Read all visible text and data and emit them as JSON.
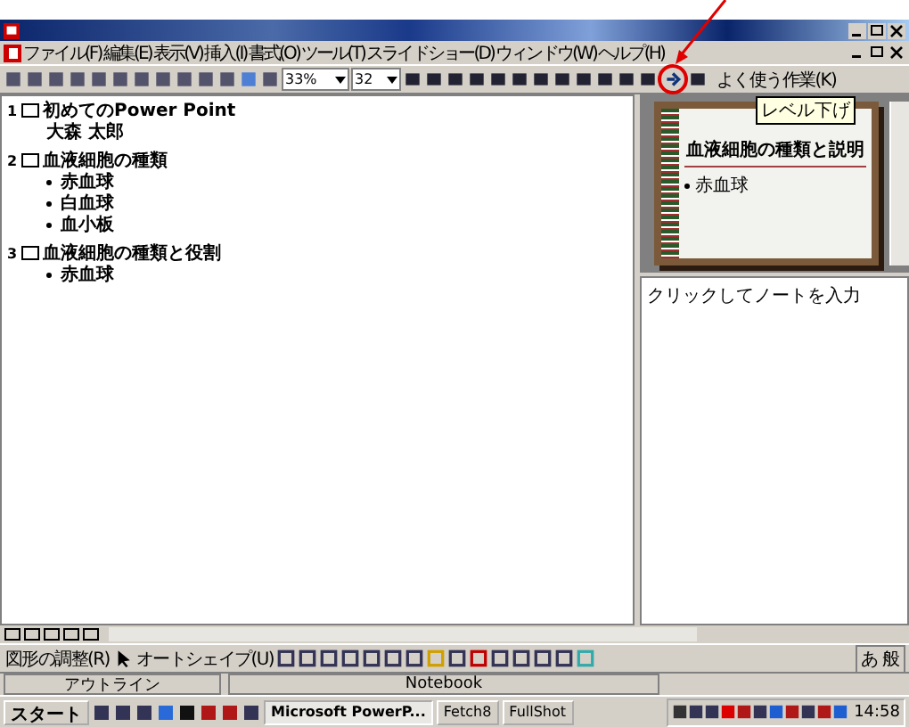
{
  "menu": [
    "ファイル(F)",
    "編集(E)",
    "表示(V)",
    "挿入(I)",
    "書式(O)",
    "ツール(T)",
    "スライドショー(D)",
    "ウィンドウ(W)",
    "ヘルプ(H)"
  ],
  "toolbar": {
    "zoom": "33%",
    "font_size": "32",
    "common_tasks": "よく使う作業(K)"
  },
  "tooltip": "レベル下げ",
  "outline": [
    {
      "number": "1",
      "title": "初めてのPower Point",
      "children": [
        {
          "kind": "text",
          "text": "大森 太郎"
        }
      ]
    },
    {
      "number": "2",
      "title": "血液細胞の種類",
      "children": [
        {
          "kind": "bullet",
          "text": "赤血球"
        },
        {
          "kind": "bullet",
          "text": "白血球"
        },
        {
          "kind": "bullet",
          "text": "血小板"
        }
      ]
    },
    {
      "number": "3",
      "title": "血液細胞の種類と役割",
      "children": [
        {
          "kind": "bullet",
          "text": "赤血球"
        }
      ]
    }
  ],
  "slide_preview": {
    "title": "血液細胞の種類と説明",
    "bullets": [
      "赤血球"
    ]
  },
  "notes": {
    "placeholder": "クリックしてノートを入力"
  },
  "drawing_toolbar": {
    "draw": "図形の調整(R)",
    "autoshapes": "オートシェイプ(U)"
  },
  "status_bar": [
    "アウトライン",
    "Notebook"
  ],
  "ime": [
    "あ",
    "般"
  ],
  "taskbar": {
    "start": "スタート",
    "tasks": [
      {
        "label": "Microsoft PowerP...",
        "selected": true
      },
      {
        "label": "Fetch8",
        "selected": false
      },
      {
        "label": "FullShot",
        "selected": false
      }
    ],
    "clock": "14:58"
  }
}
